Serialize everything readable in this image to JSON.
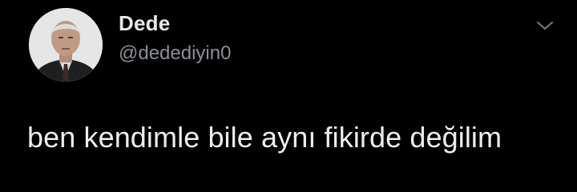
{
  "tweet": {
    "author": {
      "display_name": "Dede",
      "handle": "@dedediyin0",
      "avatar_icon": "elderly-man-portrait"
    },
    "text": "ben kendimle bile aynı fikirde değilim",
    "more_icon": "chevron-down-icon"
  },
  "colors": {
    "background": "#000000",
    "name_text": "#e9e9e9",
    "handle_text": "#8a8f95",
    "body_text": "#ededed"
  }
}
